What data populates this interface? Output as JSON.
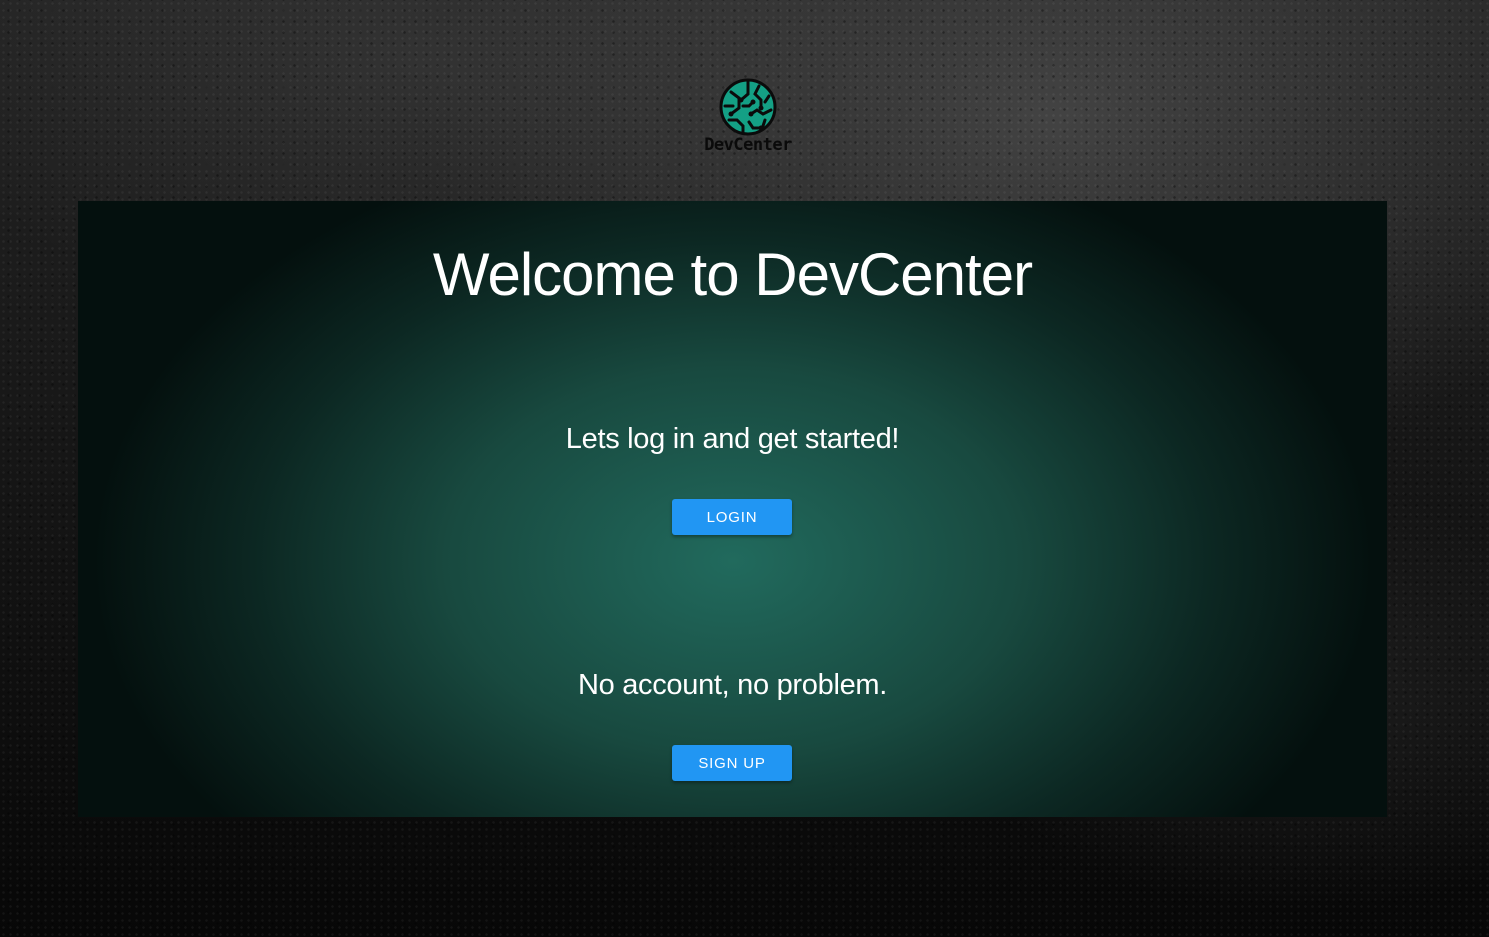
{
  "brand": {
    "logo_icon": "circuit-globe-icon",
    "logo_text": "DevCenter",
    "accent_color": "#216a5d"
  },
  "hero": {
    "title": "Welcome to DevCenter"
  },
  "login_section": {
    "prompt": "Lets log in and get started!",
    "button_label": "LOGIN"
  },
  "signup_section": {
    "prompt": "No account, no problem.",
    "button_label": "SIGN UP"
  },
  "colors": {
    "button": "#2196f3",
    "panel_center": "#216a5d",
    "panel_edge": "#04100e"
  }
}
